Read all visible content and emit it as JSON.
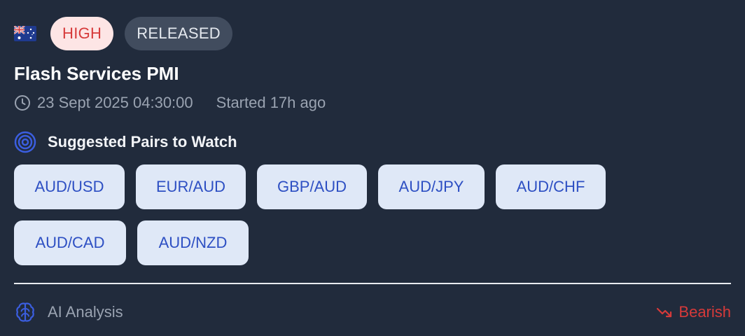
{
  "event": {
    "flag_icon": "australia-flag-icon",
    "impact_badge": "HIGH",
    "status_badge": "RELEASED",
    "title": "Flash Services PMI",
    "datetime": "23 Sept 2025 04:30:00",
    "started": "Started 17h ago"
  },
  "pairs_section": {
    "icon": "target-icon",
    "title": "Suggested Pairs to Watch",
    "pairs": [
      "AUD/USD",
      "EUR/AUD",
      "GBP/AUD",
      "AUD/JPY",
      "AUD/CHF",
      "AUD/CAD",
      "AUD/NZD"
    ]
  },
  "footer": {
    "icon": "brain-icon",
    "label": "AI Analysis",
    "sentiment": "Bearish",
    "sentiment_icon": "trending-down-icon"
  },
  "colors": {
    "background": "#212b3c",
    "high": "#d63a3a",
    "pair_bg": "#dfe8f7",
    "pair_text": "#2d4fc3",
    "accent_blue": "#3b5ee0"
  }
}
